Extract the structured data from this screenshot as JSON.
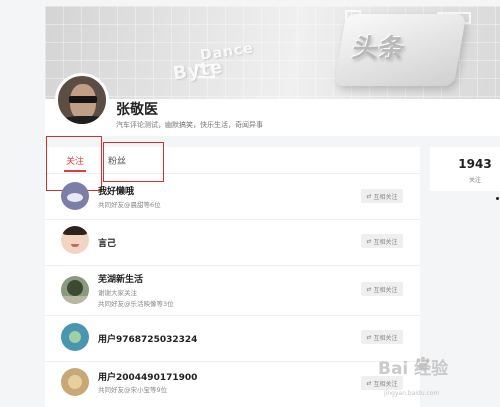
{
  "profile": {
    "name": "张敬医",
    "bio": "汽车评论测试，幽默搞笑，快乐生活，奇闻异事",
    "banner_text": {
      "dance": "Dance",
      "byte": "Byte",
      "logo": "头条"
    }
  },
  "tabs": [
    {
      "label": "关注",
      "active": true
    },
    {
      "label": "粉丝",
      "active": false
    }
  ],
  "stats": {
    "count": "1943",
    "label": "关注"
  },
  "follow_list": [
    {
      "name": "我好懒哦",
      "sub": "共同好友@晨甜等6位",
      "button": "互相关注",
      "button_icon": "⇄"
    },
    {
      "name": "言己",
      "sub": "",
      "button": "互相关注",
      "button_icon": "⇄"
    },
    {
      "name": "芜湖新生活",
      "sub": "谢谢大家关注",
      "sub2": "共同好友@乐活映像等3位",
      "button": "互相关注",
      "button_icon": "⇄"
    },
    {
      "name": "用户9768725032324",
      "sub": "",
      "button": "互相关注",
      "button_icon": "⇄"
    },
    {
      "name": "用户2004490171900",
      "sub": "共同好友@宋小宝等9位",
      "button": "互相关注",
      "button_icon": "⇄"
    }
  ],
  "watermark": {
    "brand": "Bai 经验",
    "url": "jingyan.baidu.com"
  },
  "colors": {
    "accent": "#e03d3d",
    "annotation": "#d32f2f",
    "background": "#f4f5f6"
  }
}
